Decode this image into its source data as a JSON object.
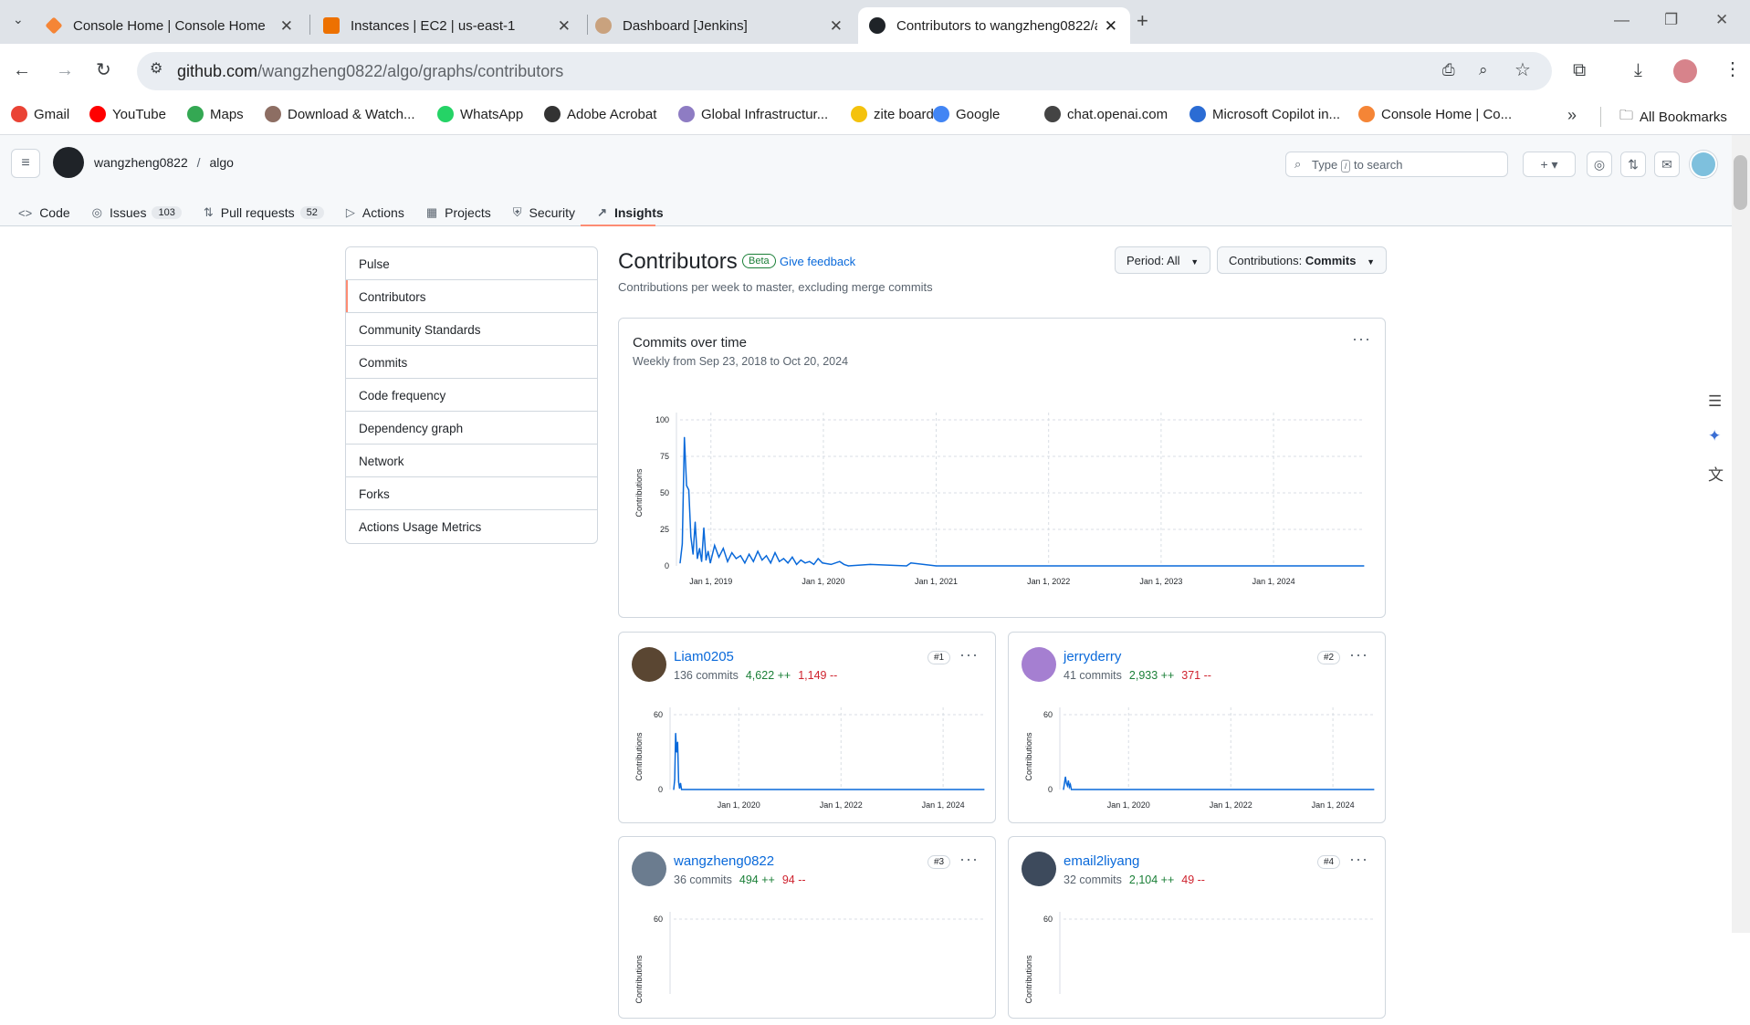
{
  "browser": {
    "tabs": [
      {
        "title": "Console Home | Console Home",
        "color": "#f58536"
      },
      {
        "title": "Instances | EC2 | us-east-1",
        "color": "#ed7100"
      },
      {
        "title": "Dashboard [Jenkins]",
        "color": "#d33833"
      },
      {
        "title": "Contributors to wangzheng0822/algo",
        "color": "#1f2328"
      }
    ],
    "url_host": "github.com",
    "url_path": "/wangzheng0822/algo/graphs/contributors",
    "bookmarks": [
      {
        "label": "Gmail",
        "color": "#ea4335"
      },
      {
        "label": "YouTube",
        "color": "#ff0000"
      },
      {
        "label": "Maps",
        "color": "#34a853"
      },
      {
        "label": "Download & Watch...",
        "color": "#8d6e63"
      },
      {
        "label": "WhatsApp",
        "color": "#25d366"
      },
      {
        "label": "Adobe Acrobat",
        "color": "#333333"
      },
      {
        "label": "Global Infrastructur...",
        "color": "#8e7cc3"
      },
      {
        "label": "zite board",
        "color": "#f4c20d"
      },
      {
        "label": "Google",
        "color": "#4285f4"
      },
      {
        "label": "chat.openai.com",
        "color": "#444444"
      },
      {
        "label": "Microsoft Copilot in...",
        "color": "#2b6cd4"
      },
      {
        "label": "Console Home | Co...",
        "color": "#f58536"
      }
    ],
    "all_bookmarks": "All Bookmarks"
  },
  "repo": {
    "owner": "wangzheng0822",
    "name": "algo",
    "search_placeholder_pre": "Type",
    "search_key": "/",
    "search_placeholder_post": "to search",
    "tabs": [
      {
        "label": "Code",
        "icon": "<>",
        "count": ""
      },
      {
        "label": "Issues",
        "icon": "◎",
        "count": "103"
      },
      {
        "label": "Pull requests",
        "icon": "⇅",
        "count": "52"
      },
      {
        "label": "Actions",
        "icon": "▷",
        "count": ""
      },
      {
        "label": "Projects",
        "icon": "▦",
        "count": ""
      },
      {
        "label": "Security",
        "icon": "⛨",
        "count": ""
      },
      {
        "label": "Insights",
        "icon": "↗",
        "count": ""
      }
    ]
  },
  "sidenav": [
    "Pulse",
    "Contributors",
    "Community Standards",
    "Commits",
    "Code frequency",
    "Dependency graph",
    "Network",
    "Forks",
    "Actions Usage Metrics"
  ],
  "page": {
    "title": "Contributors",
    "beta": "Beta",
    "feedback": "Give feedback",
    "subtitle": "Contributions per week to master, excluding merge commits",
    "period_label": "Period:",
    "period_value": "All",
    "contrib_label": "Contributions:",
    "contrib_value": "Commits"
  },
  "main_chart": {
    "title": "Commits over time",
    "subtitle": "Weekly from Sep 23, 2018 to Oct 20, 2024",
    "ylabel": "Contributions"
  },
  "contributors": [
    {
      "name": "Liam0205",
      "rank": "#1",
      "commits": "136 commits",
      "adds": "4,622 ++",
      "dels": "1,149 --",
      "avatar": "#5a4632"
    },
    {
      "name": "jerryderry",
      "rank": "#2",
      "commits": "41 commits",
      "adds": "2,933 ++",
      "dels": "371 --",
      "avatar": "#a57fd1"
    },
    {
      "name": "wangzheng0822",
      "rank": "#3",
      "commits": "36 commits",
      "adds": "494 ++",
      "dels": "94 --",
      "avatar": "#6b7c8f"
    },
    {
      "name": "email2liyang",
      "rank": "#4",
      "commits": "32 commits",
      "adds": "2,104 ++",
      "dels": "49 --",
      "avatar": "#3d4a5c"
    }
  ],
  "chart_data": [
    {
      "type": "line",
      "title": "Commits over time",
      "subtitle": "Weekly from Sep 23, 2018 to Oct 20, 2024",
      "ylabel": "Contributions",
      "ylim": [
        0,
        100
      ],
      "yticks": [
        "0",
        "25",
        "50",
        "75",
        "100"
      ],
      "xticks": [
        "Jan 1, 2019",
        "Jan 1, 2020",
        "Jan 1, 2021",
        "Jan 1, 2022",
        "Jan 1, 2023",
        "Jan 1, 2024"
      ],
      "grid": true,
      "series": [
        {
          "x": [
            "2018-09-23",
            "2018-09-30",
            "2018-10-07",
            "2018-10-14",
            "2018-10-21",
            "2018-10-28",
            "2018-11-04",
            "2018-11-11",
            "2018-11-18",
            "2018-11-25",
            "2018-12-02",
            "2018-12-09",
            "2018-12-16",
            "2018-12-23",
            "2018-12-30",
            "2019-01-13",
            "2019-01-27",
            "2019-02-10",
            "2019-02-24",
            "2019-03-10",
            "2019-03-24",
            "2019-04-07",
            "2019-04-21",
            "2019-05-05",
            "2019-05-19",
            "2019-06-02",
            "2019-06-16",
            "2019-06-30",
            "2019-07-14",
            "2019-07-28",
            "2019-08-11",
            "2019-08-25",
            "2019-09-08",
            "2019-09-22",
            "2019-10-06",
            "2019-10-20",
            "2019-11-03",
            "2019-11-17",
            "2019-12-01",
            "2019-12-15",
            "2019-12-29",
            "2020-01-26",
            "2020-02-23",
            "2020-03-08",
            "2020-03-22",
            "2020-06-01",
            "2020-09-27",
            "2020-10-11",
            "2021-01-01",
            "2024-10-20"
          ],
          "y": [
            2,
            15,
            88,
            55,
            52,
            20,
            8,
            30,
            5,
            12,
            3,
            26,
            4,
            10,
            2,
            14,
            6,
            12,
            3,
            9,
            5,
            7,
            2,
            8,
            3,
            10,
            4,
            7,
            2,
            9,
            3,
            5,
            2,
            6,
            1,
            4,
            2,
            3,
            1,
            5,
            2,
            1,
            3,
            1,
            0,
            1,
            0,
            2,
            0,
            0
          ]
        }
      ]
    },
    {
      "type": "line",
      "title": "Liam0205",
      "ylim": [
        0,
        60
      ],
      "yticks": [
        "0",
        "60"
      ],
      "xticks": [
        "Jan 1, 2020",
        "Jan 1, 2022",
        "Jan 1, 2024"
      ],
      "series": [
        {
          "x": [
            "2018-09-23",
            "2018-09-30",
            "2018-10-07",
            "2018-10-14",
            "2018-10-21",
            "2018-10-28",
            "2018-11-04",
            "2018-11-11",
            "2018-11-18",
            "2024-10-20"
          ],
          "y": [
            0,
            8,
            45,
            30,
            38,
            6,
            1,
            5,
            0,
            0
          ]
        }
      ]
    },
    {
      "type": "line",
      "title": "jerryderry",
      "ylim": [
        0,
        60
      ],
      "yticks": [
        "0",
        "60"
      ],
      "xticks": [
        "Jan 1, 2020",
        "Jan 1, 2022",
        "Jan 1, 2024"
      ],
      "series": [
        {
          "x": [
            "2018-09-23",
            "2018-10-07",
            "2018-10-14",
            "2018-10-21",
            "2018-10-28",
            "2018-11-04",
            "2018-11-11",
            "2018-11-18",
            "2024-10-20"
          ],
          "y": [
            0,
            10,
            5,
            3,
            7,
            2,
            4,
            0,
            0
          ]
        }
      ]
    }
  ]
}
